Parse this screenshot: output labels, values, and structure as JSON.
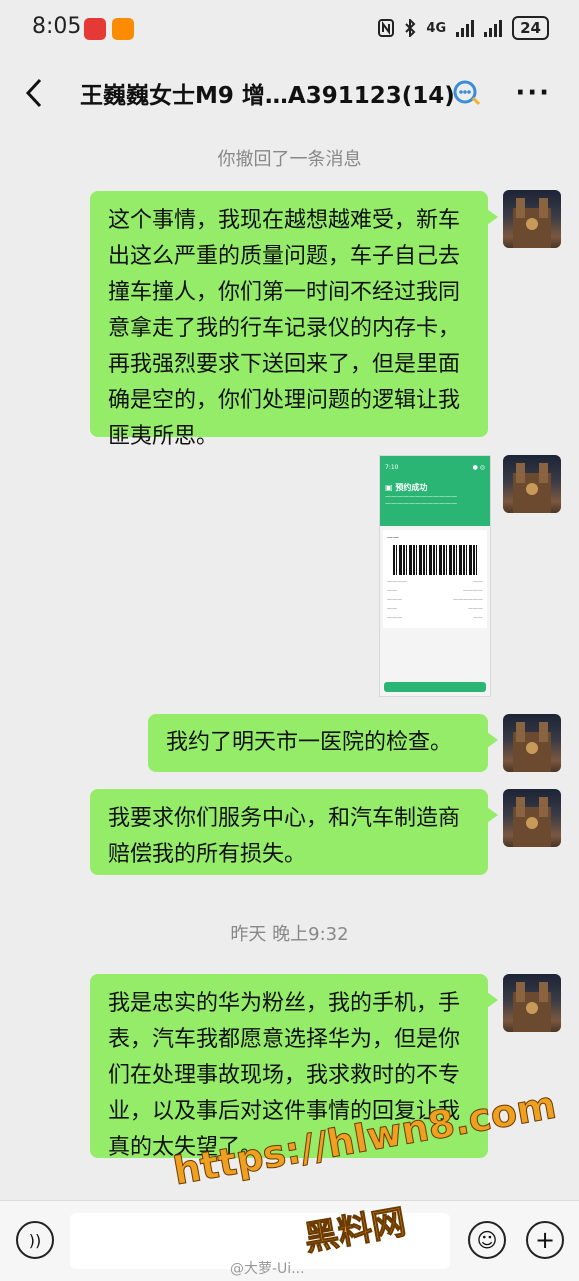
{
  "status_bar": {
    "time": "8:05",
    "network": "4G",
    "battery": "24",
    "icons": [
      "huawei-app-icon",
      "gallery-app-icon",
      "nfc-icon",
      "bluetooth-icon",
      "signal-icon",
      "battery-icon"
    ]
  },
  "header": {
    "title": "王巍巍女士M9 增…A391123(14)",
    "back_icon": "chevron-left-icon",
    "more_icon": "more-icon"
  },
  "system_messages": {
    "recalled": "你撤回了一条消息",
    "timestamp": "昨天 晚上9:32"
  },
  "messages": [
    {
      "text": "这个事情，我现在越想越难受，新车出这么严重的质量问题，车子自己去撞车撞人，你们第一时间不经过我同意拿走了我的行车记录仪的内存卡，再我强烈要求下送回来了，但是里面确是空的，你们处理问题的逻辑让我匪夷所思。"
    },
    {
      "type": "image"
    },
    {
      "text": "我约了明天市一医院的检查。"
    },
    {
      "text": "我要求你们服务中心，和汽车制造商赔偿我的所有损失。"
    },
    {
      "text": "我是忠实的华为粉丝，我的手机，手表，汽车我都愿意选择华为，但是你们在处理事故现场，我求救时的不专业，以及事后对这件事情的回复让我真的太失望了。"
    }
  ],
  "watermark": {
    "url": "https://hlwn8.com",
    "name": "黑料网",
    "credit": "@大萝-Ui..."
  },
  "colors": {
    "bubble": "#95ec69",
    "background": "#ededed"
  }
}
